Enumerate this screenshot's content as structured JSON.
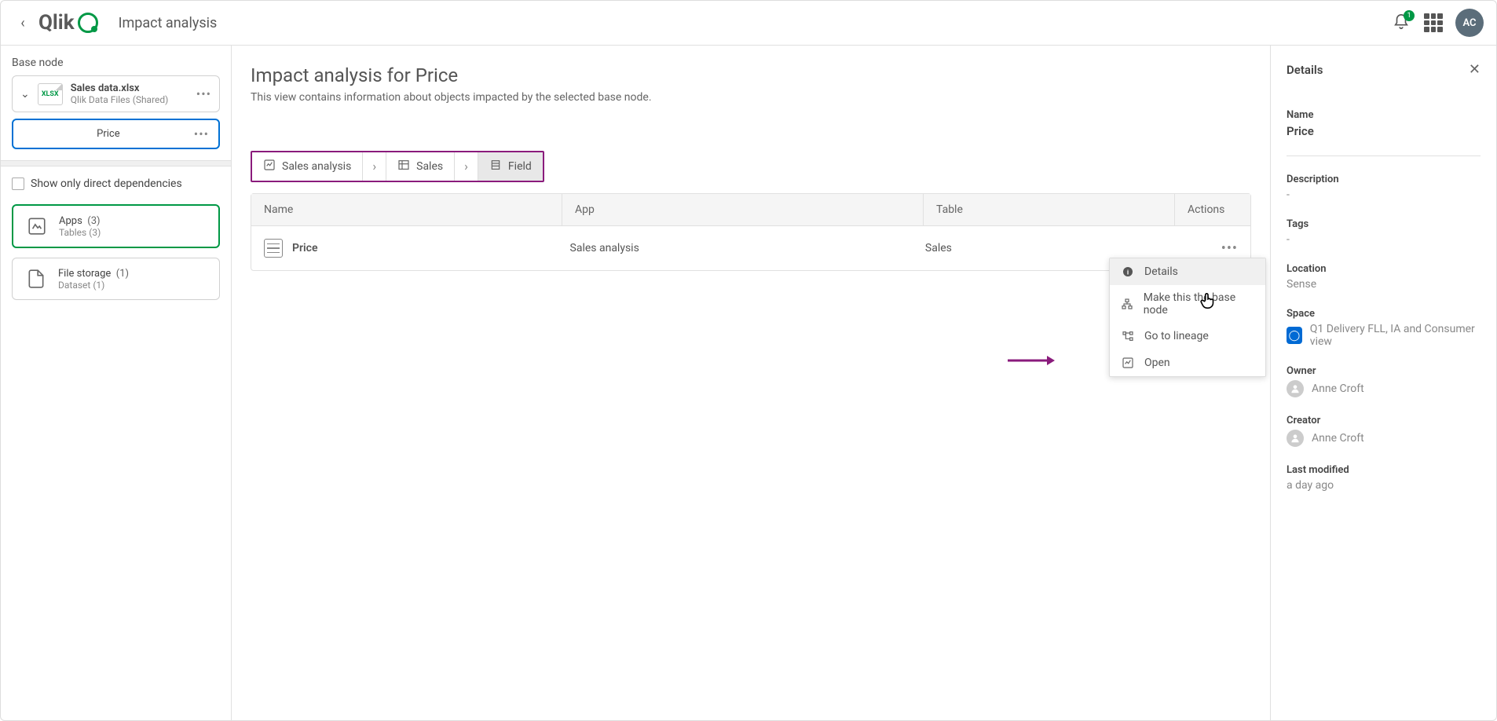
{
  "header": {
    "page_title": "Impact analysis",
    "logo_text": "Qlik",
    "notif_count": "1",
    "avatar_initials": "AC"
  },
  "sidebar": {
    "base_label": "Base node",
    "file": {
      "name": "Sales data.xlsx",
      "sub": "Qlik Data Files (Shared)",
      "badge": "XLSX"
    },
    "selected_field": "Price",
    "show_direct_label": "Show only direct dependencies",
    "filters": [
      {
        "title": "Apps",
        "count": "(3)",
        "sub": "Tables (3)"
      },
      {
        "title": "File storage",
        "count": "(1)",
        "sub": "Dataset (1)"
      }
    ]
  },
  "content": {
    "title": "Impact analysis for Price",
    "subtitle": "This view contains information about objects impacted by the selected base node.",
    "breadcrumb": [
      {
        "label": "Sales analysis"
      },
      {
        "label": "Sales"
      },
      {
        "label": "Field"
      }
    ],
    "table": {
      "headers": {
        "name": "Name",
        "app": "App",
        "table": "Table",
        "actions": "Actions"
      },
      "row": {
        "name": "Price",
        "app": "Sales analysis",
        "table": "Sales"
      }
    },
    "menu": {
      "details": "Details",
      "make_base": "Make this the base node",
      "lineage": "Go to lineage",
      "open": "Open"
    }
  },
  "details": {
    "panel_title": "Details",
    "name_label": "Name",
    "name_value": "Price",
    "desc_label": "Description",
    "desc_value": "-",
    "tags_label": "Tags",
    "tags_value": "-",
    "location_label": "Location",
    "location_value": "Sense",
    "space_label": "Space",
    "space_value": "Q1 Delivery FLL, IA and Consumer view",
    "owner_label": "Owner",
    "owner_value": "Anne Croft",
    "creator_label": "Creator",
    "creator_value": "Anne Croft",
    "modified_label": "Last modified",
    "modified_value": "a day ago"
  }
}
